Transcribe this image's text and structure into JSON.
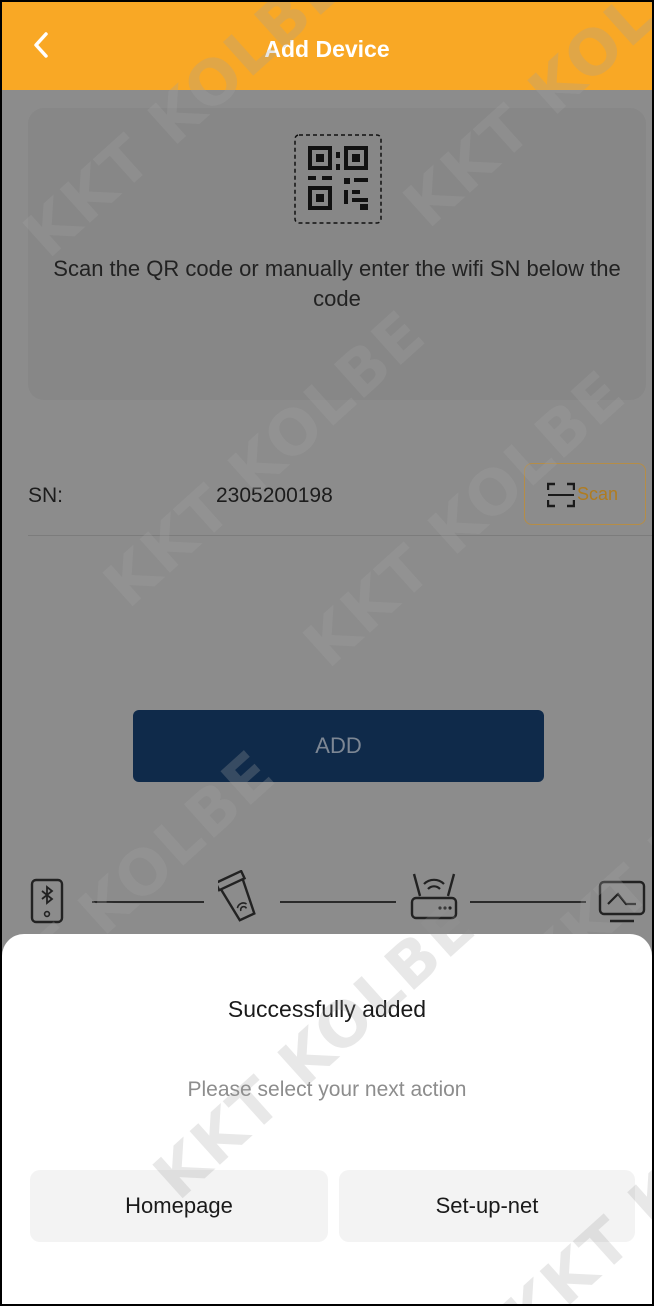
{
  "header": {
    "title": "Add Device"
  },
  "scan_card": {
    "instruction": "Scan the QR code or manually enter the wifi SN below the code"
  },
  "sn": {
    "label": "SN:",
    "value": "2305200198",
    "scan_label": "Scan"
  },
  "add_button": {
    "label": "ADD"
  },
  "steps": {
    "icons": [
      "bluetooth-phone-icon",
      "wifi-dongle-icon",
      "router-icon",
      "monitor-chart-icon"
    ]
  },
  "sheet": {
    "title": "Successfully added",
    "subtitle": "Please select your next action",
    "buttons": {
      "homepage": "Homepage",
      "setup": "Set-up-net"
    }
  },
  "watermark": {
    "text": "KKT KOLBE"
  },
  "colors": {
    "header": "#f9a825",
    "add_button": "#0f2a4a",
    "scan_accent": "#b07c20"
  }
}
